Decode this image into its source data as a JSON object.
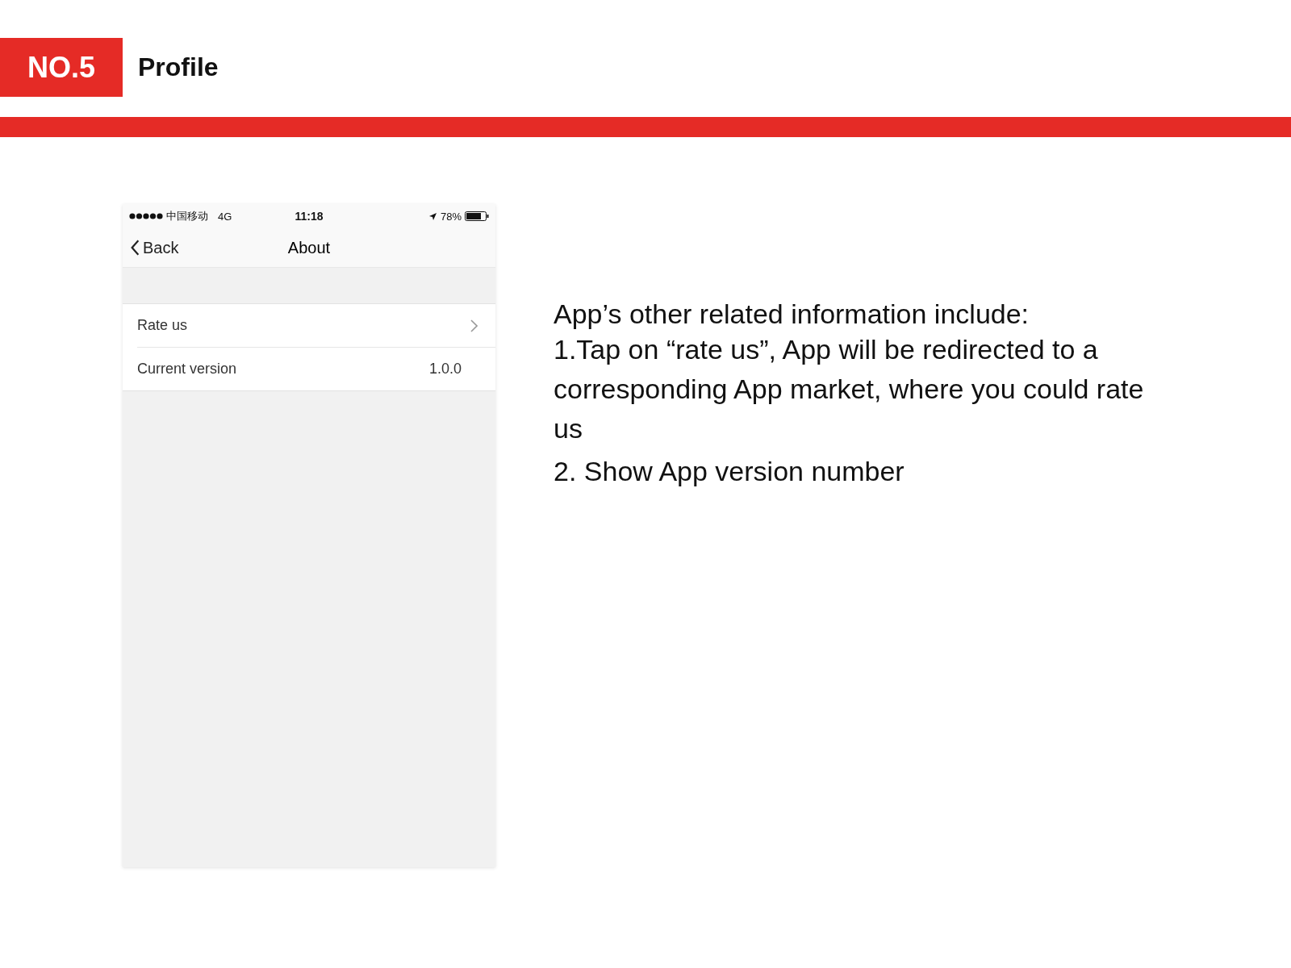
{
  "header": {
    "badge": "NO.5",
    "title": "Profile"
  },
  "phone": {
    "status_bar": {
      "carrier": "中国移动",
      "network": "4G",
      "time": "11:18",
      "battery": "78%"
    },
    "nav": {
      "back": "Back",
      "title": "About"
    },
    "rows": [
      {
        "kind": "link",
        "label": "Rate us"
      },
      {
        "kind": "value",
        "label": "Current version",
        "value": "1.0.0"
      }
    ]
  },
  "description": [
    "App’s other related information include:",
    "1.Tap on “rate us”, App will be redirected to a corresponding App market, where you could rate us",
    "2. Show App version number"
  ]
}
